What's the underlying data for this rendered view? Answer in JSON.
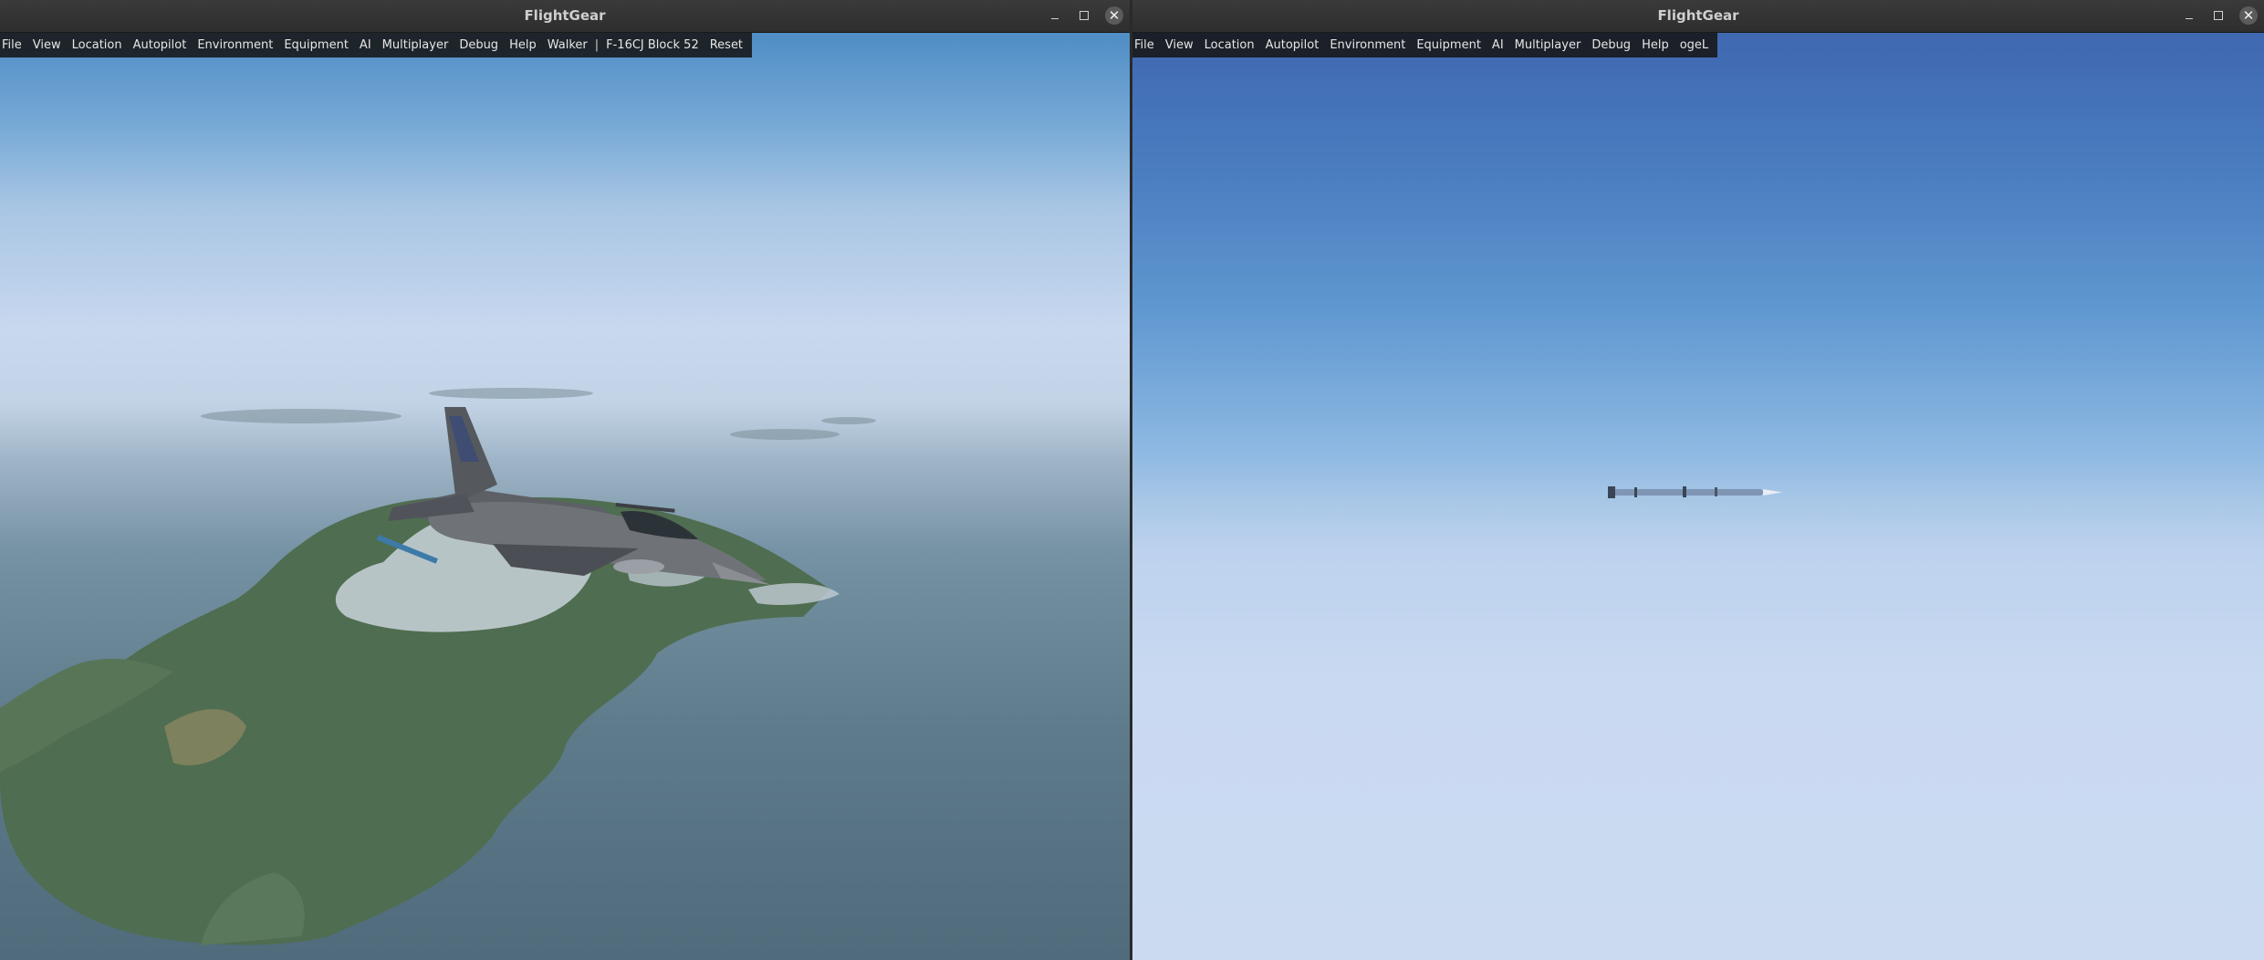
{
  "left_window": {
    "title": "FlightGear",
    "menu": [
      "File",
      "View",
      "Location",
      "Autopilot",
      "Environment",
      "Equipment",
      "AI",
      "Multiplayer",
      "Debug",
      "Help",
      "Walker"
    ],
    "separator": "|",
    "extra_menu": [
      "F-16CJ Block 52",
      "Reset"
    ],
    "scene": "f16-over-island"
  },
  "right_window": {
    "title": "FlightGear",
    "menu": [
      "File",
      "View",
      "Location",
      "Autopilot",
      "Environment",
      "Equipment",
      "AI",
      "Multiplayer",
      "Debug",
      "Help",
      "ogeL"
    ],
    "scene": "missile-in-sky"
  },
  "window_controls": [
    "minimize-icon",
    "maximize-icon",
    "close-icon"
  ],
  "close_glyph": "✕",
  "colors": {
    "titlebar": "#333333",
    "menubar": "#161616",
    "sky_left_top": "#4f8dc5",
    "sea": "#506b7b",
    "sky_right_top": "#3f68b1",
    "haze": "#cbdaf1",
    "land": "#4f6d50"
  }
}
